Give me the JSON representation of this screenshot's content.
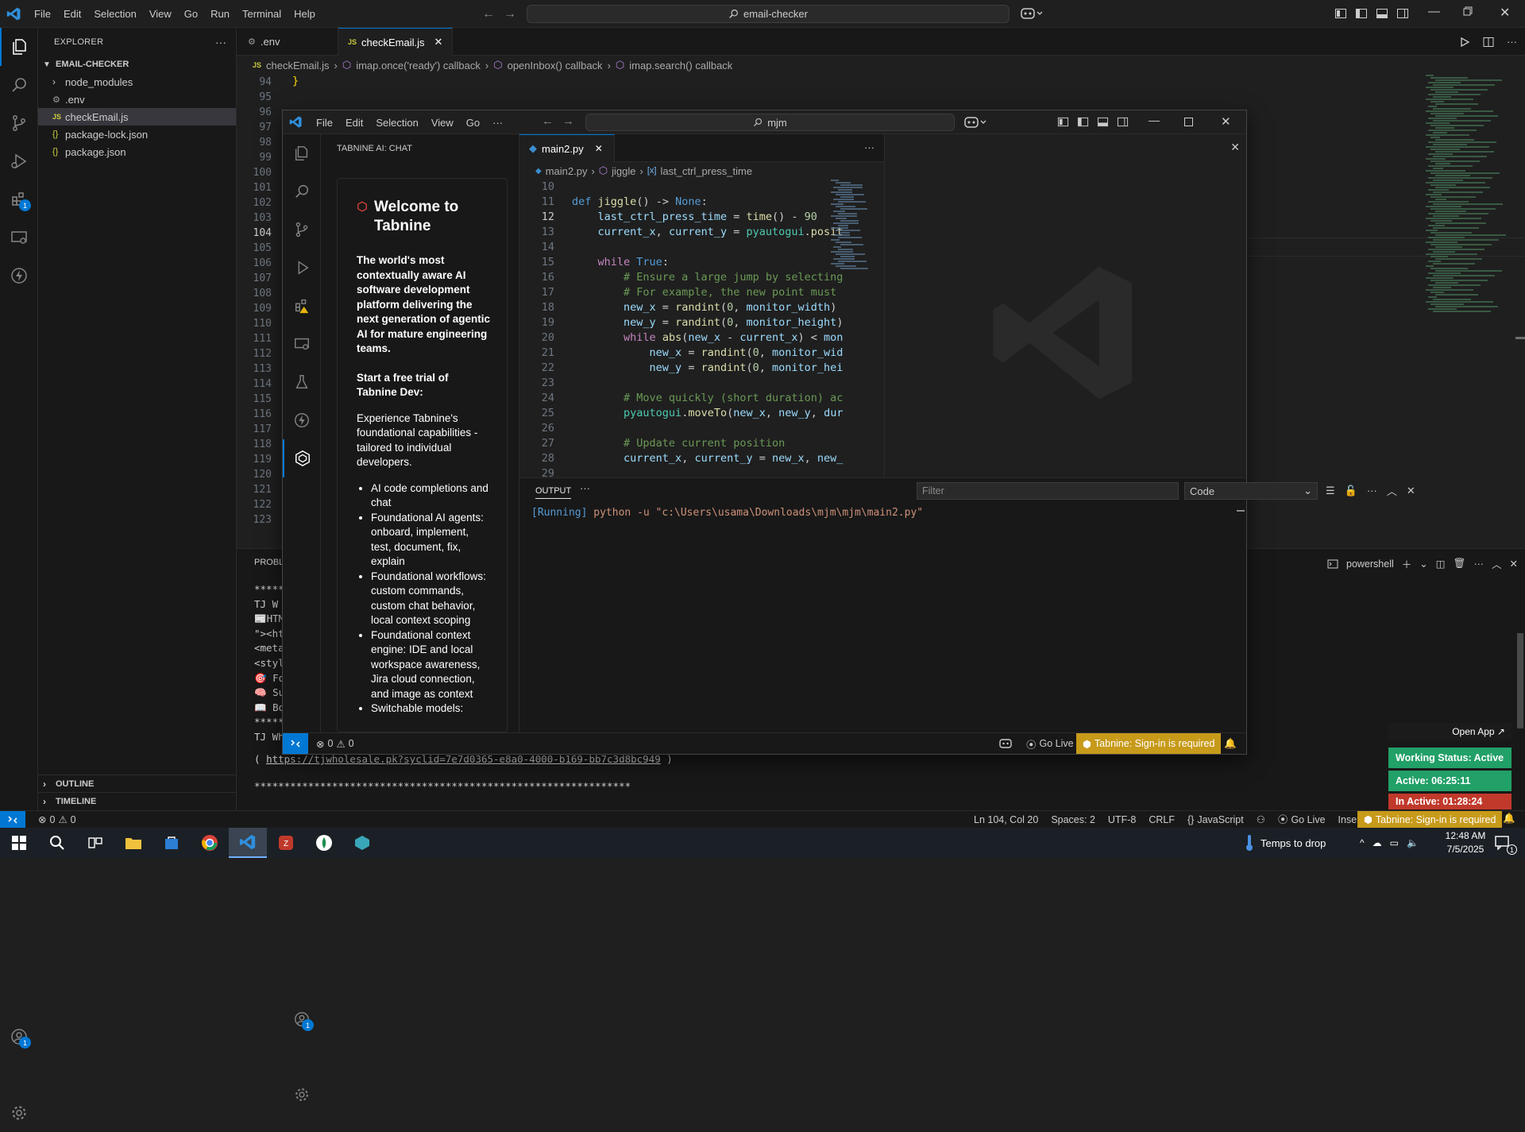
{
  "titlebar": {
    "menus": [
      "File",
      "Edit",
      "Selection",
      "View",
      "Go",
      "Run",
      "Terminal",
      "Help"
    ],
    "search": "email-checker"
  },
  "explorer": {
    "header": "EXPLORER",
    "folder": "EMAIL-CHECKER",
    "items": [
      {
        "label": "node_modules"
      },
      {
        "label": ".env"
      },
      {
        "label": "checkEmail.js"
      },
      {
        "label": "package-lock.json"
      },
      {
        "label": "package.json"
      }
    ],
    "outline": "OUTLINE",
    "timeline": "TIMELINE"
  },
  "editor": {
    "tabs": [
      ".env",
      "checkEmail.js"
    ],
    "breadcrumbs": [
      "checkEmail.js",
      "imap.once('ready') callback",
      "openInbox() callback",
      "imap.search() callback"
    ],
    "line_numbers": [
      "94",
      "95",
      "96",
      "97",
      "98",
      "99",
      "100",
      "101",
      "102",
      "103",
      "104",
      "105",
      "106",
      "107",
      "108",
      "109",
      "110",
      "111",
      "112",
      "113",
      "114",
      "115",
      "116",
      "117",
      "118",
      "119",
      "120",
      "121",
      "122",
      "123"
    ],
    "active_line": "104",
    "first_line_text": "}"
  },
  "outer_panel": {
    "tab": "PROBLI",
    "terminal_name": "powershell",
    "lines": [
      "*****",
      "TJ W",
      "📰HTM",
      "\"><ht",
      "<meta",
      "<styl",
      "🎯 Fo",
      "🧠 Su",
      "📖 Bo",
      "*****",
      "TJ Wh"
    ],
    "url_prefix": "( ",
    "url": "https://tjwholesale.pk?syclid=7e7d0365-e8a0-4000-b169-bb7c3d8bc949",
    "url_suffix": " )",
    "stars": "***************************************************************"
  },
  "inner": {
    "menus": [
      "File",
      "Edit",
      "Selection",
      "View",
      "Go"
    ],
    "search": "mjm",
    "side_header": "TABNINE AI: CHAT",
    "chat": {
      "title": "Welcome to Tabnine",
      "intro": "The world's most contextually aware AI software development platform delivering the next generation of agentic AI for mature engineering teams.",
      "trial_heading": "Start a free trial of Tabnine Dev:",
      "trial_text": "Experience Tabnine's foundational capabilities - tailored to individual developers.",
      "bullets": [
        "AI code completions and chat",
        "Foundational AI agents: onboard, implement, test, document, fix, explain",
        "Foundational workflows: custom commands, custom chat behavior, local context scoping",
        "Foundational context engine: IDE and local workspace awareness, Jira cloud connection, and image as context",
        "Switchable models:"
      ]
    },
    "tab": "main2.py",
    "breadcrumbs": [
      "main2.py",
      "jiggle",
      "last_ctrl_press_time"
    ],
    "output": {
      "tab": "OUTPUT",
      "filter_placeholder": "Filter",
      "channel": "Code",
      "running": "[Running]",
      "command": " python -u \"c:\\Users\\usama\\Downloads\\mjm\\mjm\\main2.py\""
    },
    "status": {
      "errors": "0",
      "warnings": "0",
      "go_live": "Go Live",
      "tabnine": "Tabnine: Sign-in is required"
    }
  },
  "statusbar": {
    "errors": "0",
    "warnings": "0",
    "position": "Ln 104, Col 20",
    "spaces": "Spaces: 2",
    "encoding": "UTF-8",
    "eol": "CRLF",
    "language": "JavaScript",
    "go_live": "Go Live",
    "insert": "Insert",
    "tabnine": "Tabnine: Sign-in is required"
  },
  "widget": {
    "open_app": "Open App ↗",
    "working": "Working Status: Active",
    "active": "Active: 06:25:11",
    "inactive": "In Active: 01:28:24"
  },
  "taskbar": {
    "weather": "Temps to drop",
    "time": "12:48 AM",
    "date": "7/5/2025",
    "notif_count": "1"
  },
  "colors": {
    "accent": "#0078d4",
    "tabnine_bg": "#c79a1a",
    "working_bg": "#21a067",
    "inactive_bg": "#c0392b"
  }
}
